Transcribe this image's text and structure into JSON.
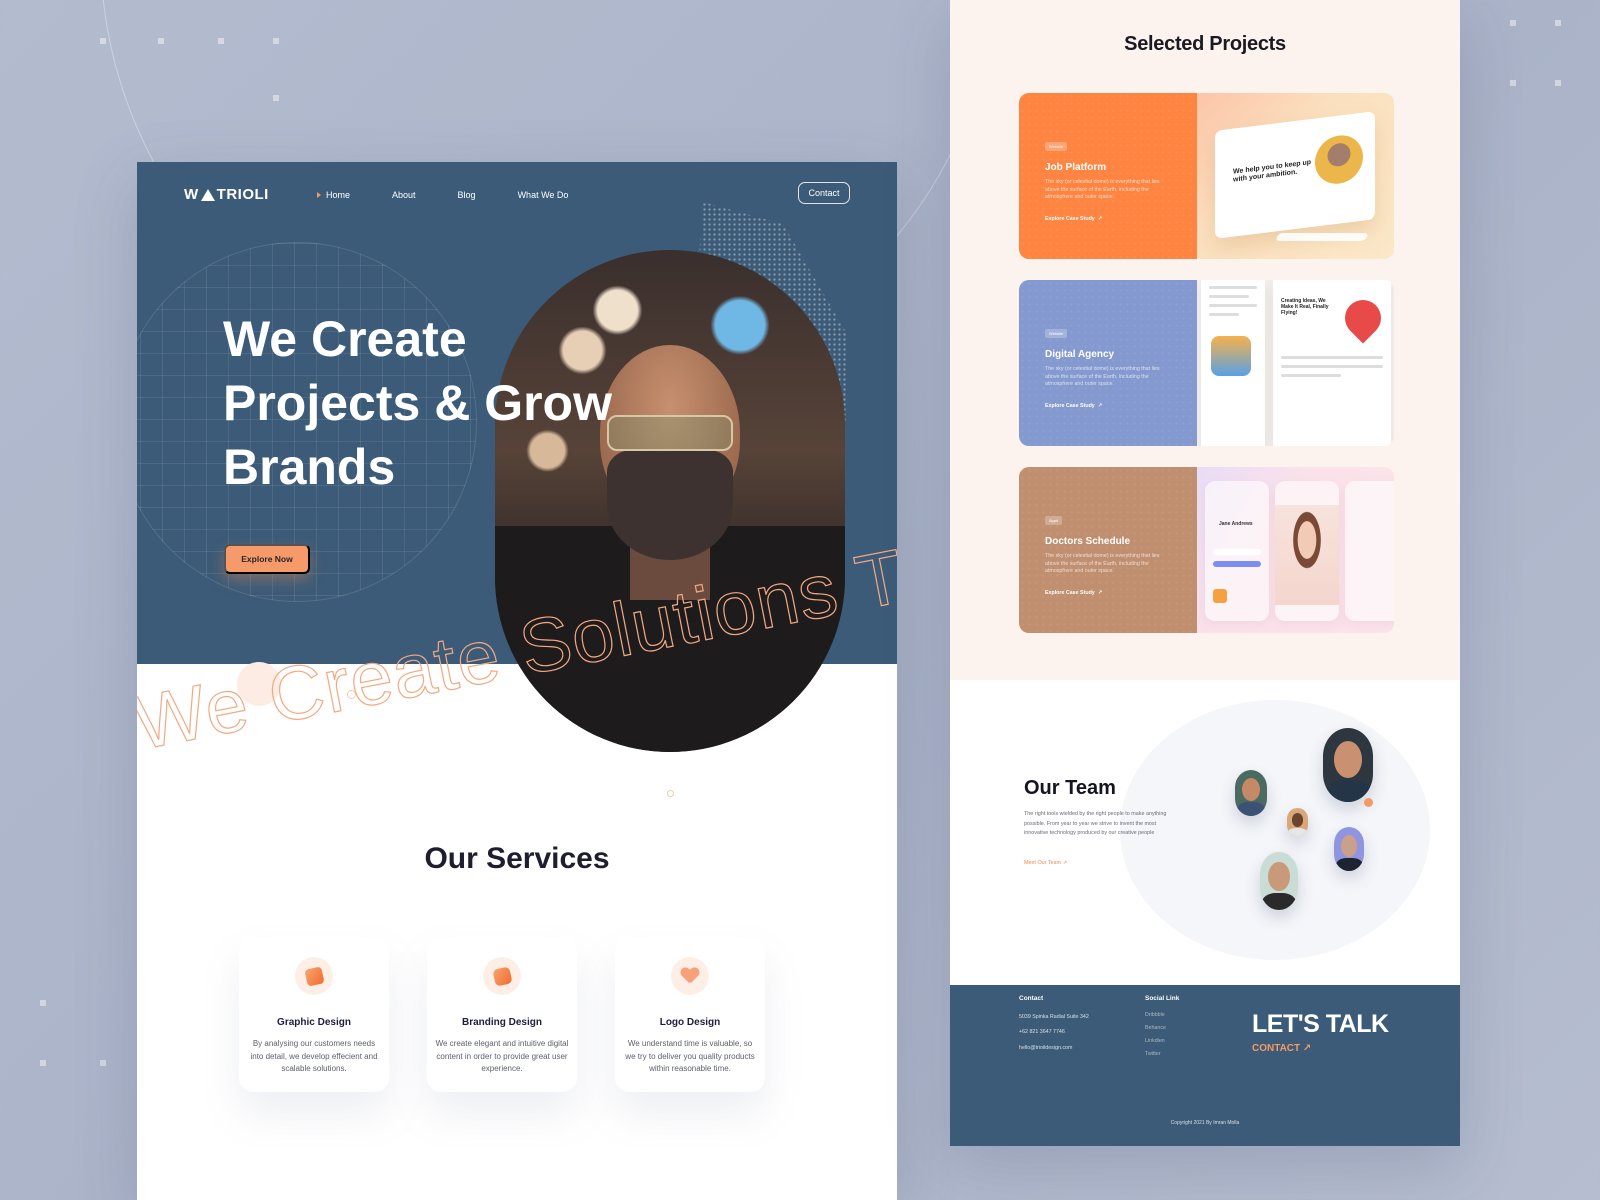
{
  "brand": {
    "name": "TRIOLI",
    "logo_mark": "W"
  },
  "nav": {
    "items": [
      {
        "label": "Home",
        "active": true
      },
      {
        "label": "About",
        "active": false
      },
      {
        "label": "Blog",
        "active": false
      },
      {
        "label": "What We Do",
        "active": false
      }
    ],
    "contact_label": "Contact"
  },
  "hero": {
    "title_lines": [
      "We Create",
      "Projects & Grow",
      "Brands"
    ],
    "cta_label": "Explore Now",
    "marquee_text": "We Create Solutions T"
  },
  "services": {
    "title": "Our Services",
    "items": [
      {
        "icon": "graphic-design-icon",
        "title": "Graphic Design",
        "description": "By analysing our customers needs into detail, we develop effecient and scalable solutions."
      },
      {
        "icon": "branding-design-icon",
        "title": "Branding Design",
        "description": "We create elegant and intuitive digital content in order to provide great user experience."
      },
      {
        "icon": "logo-design-icon",
        "title": "Logo Design",
        "description": "We understand time is valuable, so we try to deliver you quality products within reasonable time."
      }
    ]
  },
  "projects": {
    "title": "Selected Projects",
    "items": [
      {
        "badge": "Website",
        "title": "Job Platform",
        "description": "The sky (or celestial dome) is everything that lies above the surface of the Earth, including the atmosphere and outer space.",
        "link_label": "Explore Case Study",
        "color": "#fe8442",
        "preview_headline": "We help you to keep up with your ambition."
      },
      {
        "badge": "Website",
        "title": "Digital Agency",
        "description": "The sky (or celestial dome) is everything that lies above the surface of the Earth, including the atmosphere and outer space.",
        "link_label": "Explore Case Study",
        "color": "#8499cf",
        "preview_headline": "Creating Ideas, We Make It Real, Finally Flying!"
      },
      {
        "badge": "Apps",
        "title": "Doctors Schedule",
        "description": "The sky (or celestial dome) is everything that lies above the surface of the Earth, including the atmosphere and outer space.",
        "link_label": "Explore Case Study",
        "color": "#c08f6f",
        "preview_headline": "Jane Andrews"
      }
    ]
  },
  "team": {
    "title": "Our Team",
    "description": "The right tools wielded by the right people to make anything possible. From year to year we strive to invent the most innovative technology produced by our creative people",
    "link_label": "Meet Our Team"
  },
  "footer": {
    "contact": {
      "title": "Contact",
      "address": "5039 Spinka Radial Suite 342",
      "phone": "+62 821 3647 7746",
      "email": "hello@trioildesign.com"
    },
    "social": {
      "title": "Social Link",
      "links": [
        "Dribbble",
        "Behance",
        "Linkdien",
        "Twitter"
      ]
    },
    "cta_title": "LET'S TALK",
    "cta_link": "CONTACT",
    "copyright": "Copyright 2021 By Imran Molla"
  },
  "colors": {
    "primary": "#3c5b78",
    "accent": "#f59a68",
    "background": "#b3bbcf"
  }
}
